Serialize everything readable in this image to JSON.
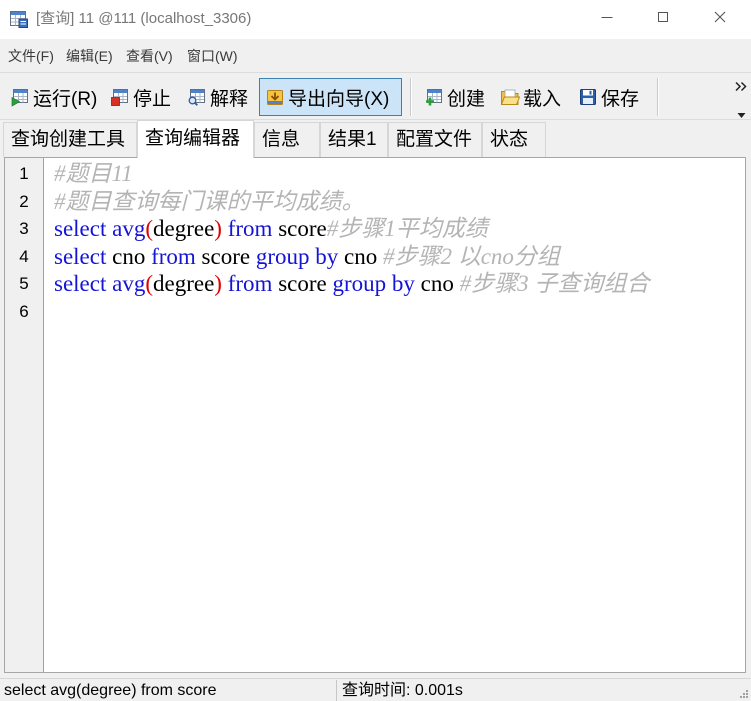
{
  "window": {
    "title": "[查询] 11 @111 (localhost_3306)",
    "app_icon": "query-window-icon",
    "controls": {
      "minimize": "minimize-icon",
      "maximize": "maximize-icon",
      "close": "close-icon"
    }
  },
  "menu": {
    "items": [
      {
        "label": "文件(F)"
      },
      {
        "label": "编辑(E)"
      },
      {
        "label": "查看(V)"
      },
      {
        "label": "窗口(W)"
      }
    ]
  },
  "toolbar": {
    "buttons": [
      {
        "label": "运行(R)",
        "icon": "run-icon"
      },
      {
        "label": "停止",
        "icon": "stop-icon"
      },
      {
        "label": "解释",
        "icon": "explain-icon"
      },
      {
        "label": "导出向导(X)",
        "icon": "export-wizard-icon",
        "pressed": true
      },
      {
        "label": "创建",
        "icon": "create-icon"
      },
      {
        "label": "载入",
        "icon": "load-icon"
      },
      {
        "label": "保存",
        "icon": "save-icon"
      }
    ],
    "overflow_icon": "overflow-chevron-icon",
    "dropdown_icon": "toolbar-dropdown-icon"
  },
  "tabs": [
    {
      "label": "查询创建工具",
      "active": false
    },
    {
      "label": "查询编辑器",
      "active": true
    },
    {
      "label": "信息",
      "active": false
    },
    {
      "label": "结果1",
      "active": false
    },
    {
      "label": "配置文件",
      "active": false
    },
    {
      "label": "状态",
      "active": false
    }
  ],
  "editor": {
    "line_numbers": [
      1,
      2,
      3,
      4,
      5,
      6
    ],
    "lines": [
      {
        "tokens": [
          {
            "text": "#题目11",
            "color": "#b4b4b4",
            "italic": true
          }
        ]
      },
      {
        "tokens": [
          {
            "text": "#题目查询每门课的平均成绩。",
            "color": "#b4b4b4",
            "italic": true
          }
        ]
      },
      {
        "tokens": [
          {
            "text": "select avg",
            "color": "#1414d6"
          },
          {
            "text": "(",
            "color": "#e00000"
          },
          {
            "text": "degree",
            "color": "#000000"
          },
          {
            "text": ")",
            "color": "#e00000"
          },
          {
            "text": " from ",
            "color": "#1414d6"
          },
          {
            "text": "score",
            "color": "#000000"
          },
          {
            "text": "#步骤1平均成绩",
            "color": "#b4b4b4",
            "italic": true
          }
        ]
      },
      {
        "tokens": [
          {
            "text": "select ",
            "color": "#1414d6"
          },
          {
            "text": "cno ",
            "color": "#000000"
          },
          {
            "text": "from ",
            "color": "#1414d6"
          },
          {
            "text": "score ",
            "color": "#000000"
          },
          {
            "text": "group by ",
            "color": "#1414d6"
          },
          {
            "text": "cno ",
            "color": "#000000"
          },
          {
            "text": "#步骤2 以cno分组",
            "color": "#b4b4b4",
            "italic": true
          }
        ]
      },
      {
        "tokens": [
          {
            "text": "select avg",
            "color": "#1414d6"
          },
          {
            "text": "(",
            "color": "#e00000"
          },
          {
            "text": "degree",
            "color": "#000000"
          },
          {
            "text": ")",
            "color": "#e00000"
          },
          {
            "text": " from ",
            "color": "#1414d6"
          },
          {
            "text": "score ",
            "color": "#000000"
          },
          {
            "text": "group by ",
            "color": "#1414d6"
          },
          {
            "text": "cno ",
            "color": "#000000"
          },
          {
            "text": "#步骤3 子查询组合",
            "color": "#b4b4b4",
            "italic": true
          }
        ]
      },
      {
        "tokens": []
      }
    ]
  },
  "colors": {
    "pressed_button_bg": "#cce4f7",
    "pressed_button_border": "#3c7fb1"
  },
  "status_bar": {
    "current_sql": "select avg(degree) from score",
    "query_time": "查询时间: 0.001s",
    "grip_icon": "resize-grip-icon"
  }
}
